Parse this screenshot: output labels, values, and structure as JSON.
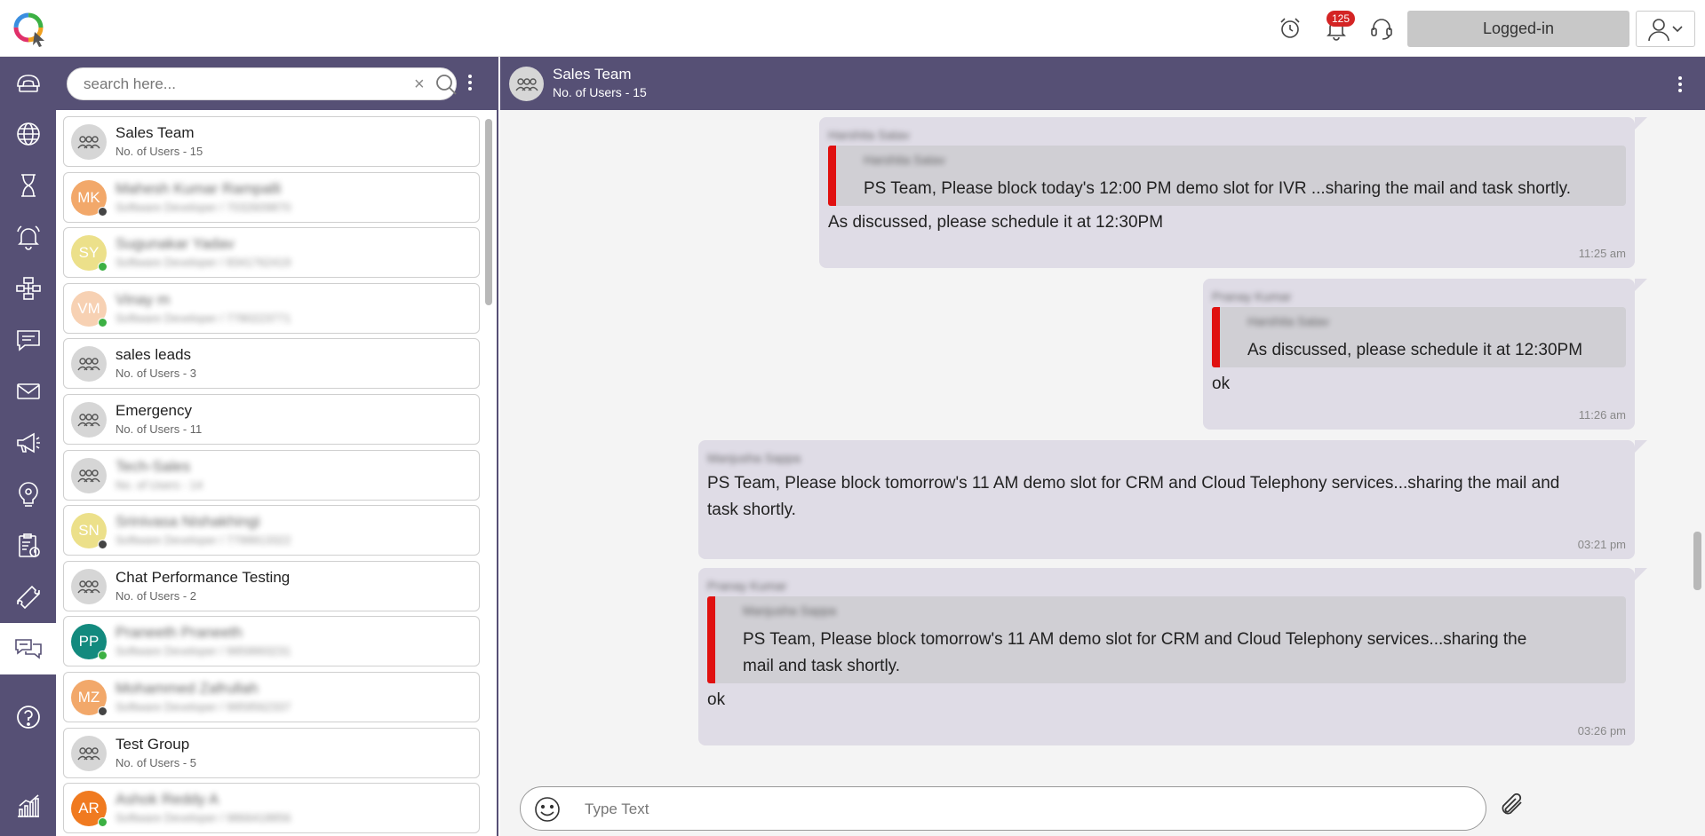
{
  "topbar": {
    "notification_count": "125",
    "status_label": "Logged-in"
  },
  "sidebar": {
    "items": [
      {
        "icon": "phone-icon"
      },
      {
        "icon": "globe-icon"
      },
      {
        "icon": "hourglass-icon"
      },
      {
        "icon": "bell-icon"
      },
      {
        "icon": "flow-icon"
      },
      {
        "icon": "chat-icon"
      },
      {
        "icon": "mail-icon"
      },
      {
        "icon": "megaphone-icon"
      },
      {
        "icon": "lightbulb-icon"
      },
      {
        "icon": "clipboard-icon"
      },
      {
        "icon": "ticket-icon"
      },
      {
        "icon": "chat-bubbles-icon",
        "active": true
      },
      {
        "icon": "help-icon"
      },
      {
        "icon": "analytics-icon"
      }
    ]
  },
  "search": {
    "placeholder": "search here...",
    "clear": "×"
  },
  "contacts": [
    {
      "type": "group",
      "name": "Sales Team",
      "sub": "No. of Users - 15",
      "blurred": false
    },
    {
      "type": "user",
      "initials": "MK",
      "color": "#f2a86a",
      "status": "#444444",
      "name": "Mahesh Kumar Rampalli",
      "sub": "Software Developer / 7032609870",
      "blurred": true
    },
    {
      "type": "user",
      "initials": "SY",
      "color": "#ece08a",
      "status": "#3cb043",
      "name": "Sugunakar Yadav",
      "sub": "Software Developer / 8341762419",
      "blurred": true
    },
    {
      "type": "user",
      "initials": "VM",
      "color": "#f7d1b3",
      "status": "#3cb043",
      "name": "Vinay m",
      "sub": "Software Developer / 7780223771",
      "blurred": true
    },
    {
      "type": "group",
      "name": "sales leads",
      "sub": "No. of Users - 3",
      "blurred": false
    },
    {
      "type": "group",
      "name": "Emergency",
      "sub": "No. of Users - 11",
      "blurred": false
    },
    {
      "type": "group",
      "name": "Tech-Sales",
      "sub": "No. of Users - 14",
      "blurred": true
    },
    {
      "type": "user",
      "initials": "SN",
      "color": "#ece08a",
      "status": "#444444",
      "name": "Srinivasa Nishakhingi",
      "sub": "Software Developer / 7799913322",
      "blurred": true
    },
    {
      "type": "group",
      "name": "Chat Performance Testing",
      "sub": "No. of Users - 2",
      "blurred": false
    },
    {
      "type": "user",
      "initials": "PP",
      "color": "#138a7e",
      "status": "#3cb043",
      "name": "Praneeth Praneeth",
      "sub": "Software Developer / 9959993231",
      "blurred": true
    },
    {
      "type": "user",
      "initials": "MZ",
      "color": "#f2a86a",
      "status": "#444444",
      "name": "Mohammed Zafrullah",
      "sub": "Software Developer / 9959562337",
      "blurred": true
    },
    {
      "type": "group",
      "name": "Test Group",
      "sub": "No. of Users - 5",
      "blurred": false
    },
    {
      "type": "user",
      "initials": "AR",
      "color": "#f07a20",
      "status": "#3cb043",
      "name": "Ashok Reddy A",
      "sub": "Software Developer / 9866418856",
      "blurred": true
    }
  ],
  "chat": {
    "title": "Sales Team",
    "subtitle": "No. of Users - 15",
    "messages": [
      {
        "sender": "Harshita Satav",
        "quote_sender": "Harshita Satav",
        "quote": "PS Team, Please block today's 12:00 PM demo slot for IVR ...sharing the mail and task shortly.",
        "text": "As discussed, please schedule it at 12:30PM",
        "time": "11:25 am"
      },
      {
        "sender": "Pranay Kumar",
        "quote_sender": "Harshita Satav",
        "quote": "As discussed, please schedule it at 12:30PM",
        "text": "ok",
        "time": "11:26 am"
      },
      {
        "sender": "Manjusha Sappa",
        "text_line1": "PS Team, Please block tomorrow's 11 AM demo slot for CRM and Cloud Telephony services...sharing the mail and",
        "text_line2": "task shortly.",
        "time": "03:21 pm"
      },
      {
        "sender": "Pranay Kumar",
        "quote_sender": "Manjusha Sappa",
        "quote_line1": "PS Team, Please block tomorrow's 11 AM demo slot for CRM and Cloud Telephony services...sharing the",
        "quote_line2": "mail and task shortly.",
        "text": "ok",
        "time": "03:26 pm"
      }
    ]
  },
  "composer": {
    "placeholder": "Type Text"
  },
  "colors": {
    "brand": "#565075",
    "bubble": "#dfdce6",
    "quote_bar": "#e01010",
    "badge": "#d42424"
  }
}
